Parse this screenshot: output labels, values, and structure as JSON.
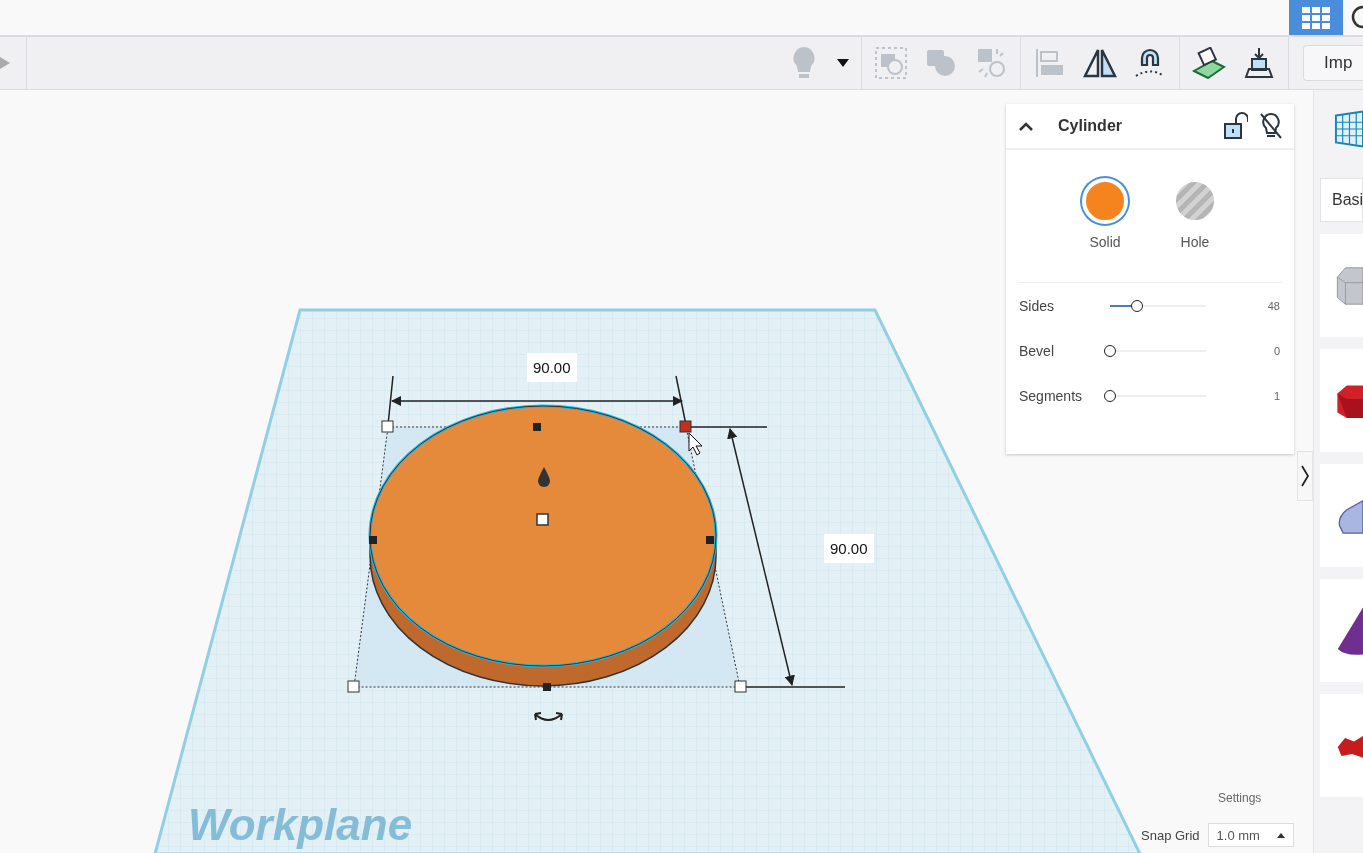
{
  "view_button": {
    "selected": true
  },
  "toolbar": {
    "tools": [
      {
        "kind": "bulb",
        "disabled": true
      },
      {
        "kind": "caret",
        "disabled": false
      },
      {
        "kind": "group",
        "disabled": true
      },
      {
        "kind": "union",
        "disabled": true
      },
      {
        "kind": "ungroup",
        "disabled": true
      },
      {
        "kind": "align",
        "disabled": true
      },
      {
        "kind": "mirror",
        "disabled": false
      },
      {
        "kind": "magnet",
        "disabled": false
      },
      {
        "kind": "workplane",
        "disabled": false
      },
      {
        "kind": "drop",
        "disabled": false
      }
    ],
    "import_button": {
      "label": "Imp"
    }
  },
  "canvas": {
    "workplane_label": "Workplane",
    "width_label": "90.00",
    "length_label": "90.00"
  },
  "inspector": {
    "title": "Cylinder",
    "expanded": true,
    "locked": false,
    "modes": [
      {
        "label": "Solid",
        "selected": true
      },
      {
        "label": "Hole",
        "selected": false
      }
    ],
    "properties": [
      {
        "name": "Sides",
        "level": 0.28,
        "reading": "48"
      },
      {
        "name": "Bevel",
        "level": 0,
        "reading": "0"
      },
      {
        "name": "Segments",
        "level": 0,
        "reading": "1"
      }
    ]
  },
  "library": {
    "category": "Basi",
    "tiles": [
      {
        "kind": "box-hole"
      },
      {
        "kind": "box"
      },
      {
        "kind": "blob"
      },
      {
        "kind": "cone"
      },
      {
        "kind": "scribble"
      }
    ]
  },
  "settings_label": "Settings",
  "snap_grid": {
    "label": "Snap Grid",
    "value": "1.0 mm"
  }
}
